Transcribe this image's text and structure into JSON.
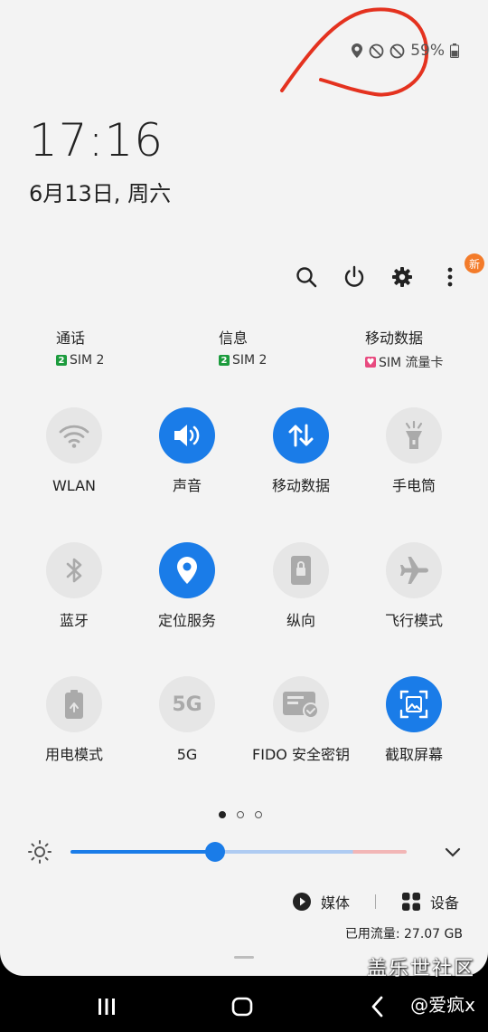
{
  "status_bar": {
    "battery_text": "59%"
  },
  "lock": {
    "time": "17:16",
    "date": "6月13日, 周六"
  },
  "toolbar": {
    "new_badge": "新"
  },
  "sims": [
    {
      "title": "通话",
      "sim": "SIM 2",
      "badge": "2",
      "badge_color": "#1c9b3d"
    },
    {
      "title": "信息",
      "sim": "SIM 2",
      "badge": "2",
      "badge_color": "#1c9b3d"
    },
    {
      "title": "移动数据",
      "sim": "SIM 流量卡",
      "badge": "♥",
      "badge_color": "#e84a7f"
    }
  ],
  "tiles": [
    {
      "label": "WLAN",
      "icon": "wifi-icon",
      "on": false
    },
    {
      "label": "声音",
      "icon": "volume-icon",
      "on": true
    },
    {
      "label": "移动数据",
      "icon": "data-arrows-icon",
      "on": true
    },
    {
      "label": "手电筒",
      "icon": "flashlight-icon",
      "on": false
    },
    {
      "label": "蓝牙",
      "icon": "bluetooth-icon",
      "on": false
    },
    {
      "label": "定位服务",
      "icon": "location-icon",
      "on": true
    },
    {
      "label": "纵向",
      "icon": "portrait-lock-icon",
      "on": false
    },
    {
      "label": "飞行模式",
      "icon": "airplane-icon",
      "on": false
    },
    {
      "label": "用电模式",
      "icon": "power-mode-icon",
      "on": false
    },
    {
      "label": "5G",
      "icon": "5g-icon",
      "on": false
    },
    {
      "label": "FIDO 安全密钥",
      "icon": "fido-icon",
      "on": false
    },
    {
      "label": "截取屏幕",
      "icon": "screenshot-icon",
      "on": true
    }
  ],
  "icon_5g_text": "5G",
  "brightness": {
    "level": 0.43
  },
  "media": {
    "media_label": "媒体",
    "devices_label": "设备"
  },
  "usage": "已用流量: 27.07 GB",
  "watermark": {
    "line1": "盖乐世社区",
    "line2": "@爱疯x"
  },
  "colors": {
    "accent": "#1a7ce8",
    "panel": "#f3f3f3",
    "badge_orange": "#f37b2a"
  }
}
